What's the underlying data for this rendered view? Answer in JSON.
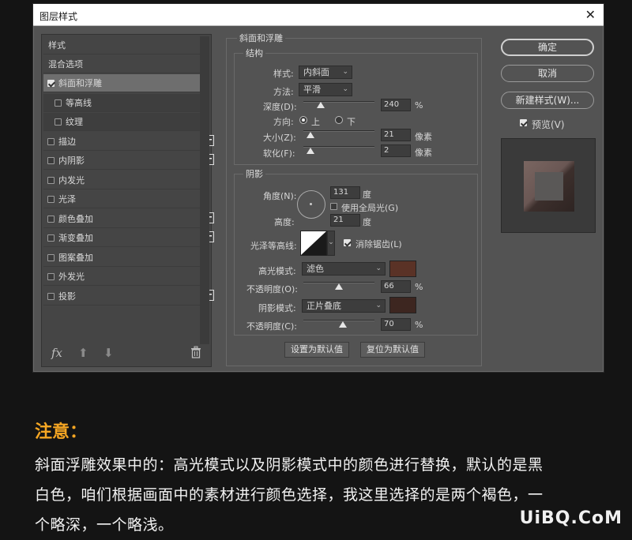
{
  "dialog": {
    "title": "图层样式",
    "close_glyph": "✕"
  },
  "left_list": {
    "styles_header": "样式",
    "blend_options": "混合选项",
    "items": [
      {
        "label": "斜面和浮雕",
        "checked": true,
        "selected": true,
        "plus": false
      },
      {
        "label": "等高线",
        "checked": false,
        "selected": false,
        "plus": false,
        "sub": true
      },
      {
        "label": "纹理",
        "checked": false,
        "selected": false,
        "plus": false,
        "sub": true
      },
      {
        "label": "描边",
        "checked": false,
        "selected": false,
        "plus": true
      },
      {
        "label": "内阴影",
        "checked": false,
        "selected": false,
        "plus": true
      },
      {
        "label": "内发光",
        "checked": false,
        "selected": false,
        "plus": false
      },
      {
        "label": "光泽",
        "checked": false,
        "selected": false,
        "plus": false
      },
      {
        "label": "颜色叠加",
        "checked": false,
        "selected": false,
        "plus": true
      },
      {
        "label": "渐变叠加",
        "checked": false,
        "selected": false,
        "plus": true
      },
      {
        "label": "图案叠加",
        "checked": false,
        "selected": false,
        "plus": false
      },
      {
        "label": "外发光",
        "checked": false,
        "selected": false,
        "plus": false
      },
      {
        "label": "投影",
        "checked": false,
        "selected": false,
        "plus": true
      }
    ],
    "bottom": {
      "fx": "fx",
      "up": "⬆",
      "down": "⬇",
      "trash": "🗑",
      "fx_icon": "fx-icon",
      "trash_icon": "trash-icon"
    }
  },
  "bevel": {
    "section_title": "斜面和浮雕",
    "structure_title": "结构",
    "style_label": "样式:",
    "style_value": "内斜面",
    "technique_label": "方法:",
    "technique_value": "平滑",
    "depth_label": "深度(D):",
    "depth_value": "240",
    "depth_unit": "%",
    "depth_level": 0.24,
    "direction_label": "方向:",
    "direction_up": "上",
    "direction_down": "下",
    "size_label": "大小(Z):",
    "size_value": "21",
    "size_unit": "像素",
    "size_level": 0.1,
    "soften_label": "软化(F):",
    "soften_value": "2",
    "soften_unit": "像素",
    "soften_level": 0.1
  },
  "shading": {
    "title": "阴影",
    "angle_label": "角度(N):",
    "angle_value": "131",
    "angle_unit": "度",
    "global_light_label": "使用全局光(G)",
    "altitude_label": "高度:",
    "altitude_value": "21",
    "altitude_unit": "度",
    "gloss_label": "光泽等高线:",
    "antialias_label": "消除锯齿(L)",
    "highlight_mode_label": "高光模式:",
    "highlight_mode_value": "滤色",
    "highlight_color": "#5a3226",
    "highlight_opacity_label": "不透明度(O):",
    "highlight_opacity_value": "66",
    "highlight_opacity_level": 0.5,
    "shadow_mode_label": "阴影模式:",
    "shadow_mode_value": "正片叠底",
    "shadow_color": "#3d2620",
    "shadow_opacity_label": "不透明度(C):",
    "shadow_opacity_value": "70",
    "shadow_opacity_level": 0.55,
    "percent": "%"
  },
  "footer_buttons": {
    "set_default": "设置为默认值",
    "reset_default": "复位为默认值"
  },
  "right": {
    "ok": "确定",
    "cancel": "取消",
    "new_style": "新建样式(W)...",
    "preview": "预览(V)"
  },
  "note": {
    "heading": "注意：",
    "line1": "斜面浮雕效果中的：高光模式以及阴影模式中的颜色进行替换，默认的是黑",
    "line2": "白色，咱们根据画面中的素材进行颜色选择，我这里选择的是两个褐色，一",
    "line3": "个略深，一个略浅。"
  },
  "watermark": "UiBQ.CoM"
}
